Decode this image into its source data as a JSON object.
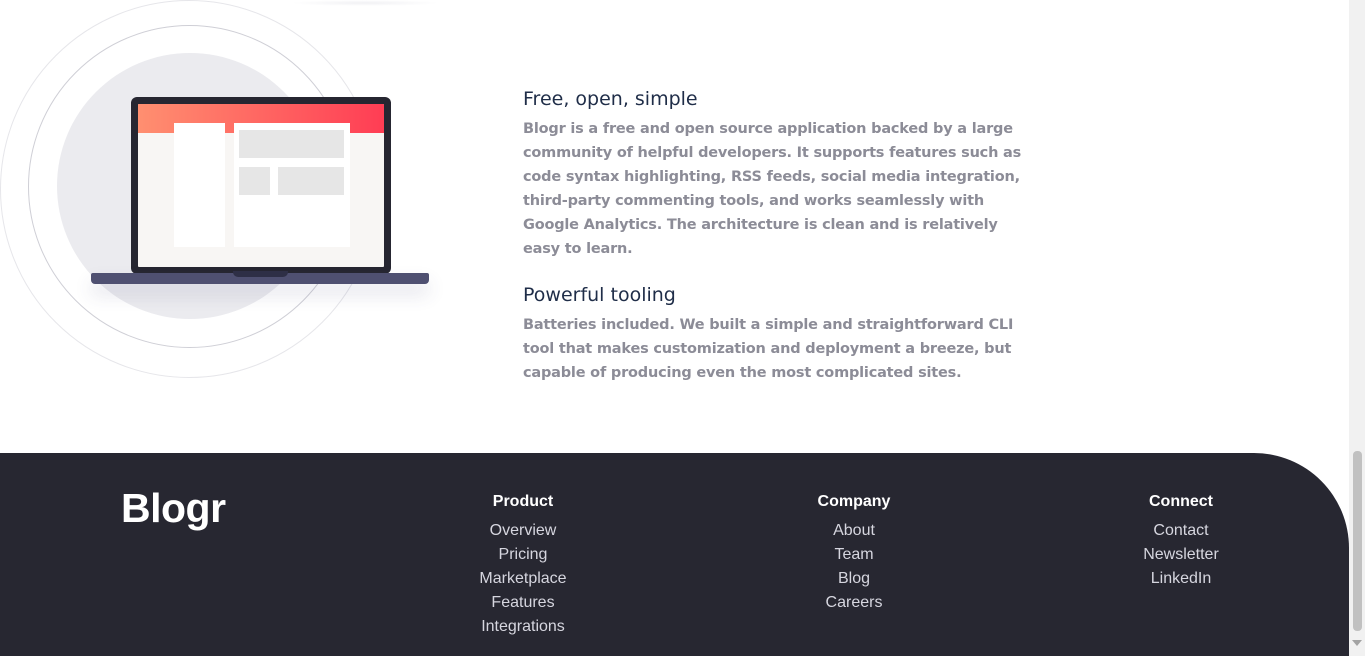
{
  "features": [
    {
      "title": "Free, open, simple",
      "text": "Blogr is a free and open source application backed by a large community of helpful developers. It supports features such as code syntax highlighting, RSS feeds, social media integration, third-party commenting tools, and works seamlessly with Google Analytics. The architecture is clean and is relatively easy to learn."
    },
    {
      "title": "Powerful tooling",
      "text": "Batteries included. We built a simple and straightforward CLI tool that makes customization and deployment a breeze, but capable of producing even the most complicated sites."
    }
  ],
  "footer": {
    "logo": "Blogr",
    "columns": [
      {
        "title": "Product",
        "links": [
          "Overview",
          "Pricing",
          "Marketplace",
          "Features",
          "Integrations"
        ]
      },
      {
        "title": "Company",
        "links": [
          "About",
          "Team",
          "Blog",
          "Careers"
        ]
      },
      {
        "title": "Connect",
        "links": [
          "Contact",
          "Newsletter",
          "LinkedIn"
        ]
      }
    ]
  },
  "colors": {
    "footer_bg": "#272731",
    "heading": "#1f2d48",
    "body_text": "#8c8c97",
    "accent_gradient_start": "#ff8f70",
    "accent_gradient_end": "#ff3d54"
  },
  "icons": [
    "laptop-illustration"
  ]
}
